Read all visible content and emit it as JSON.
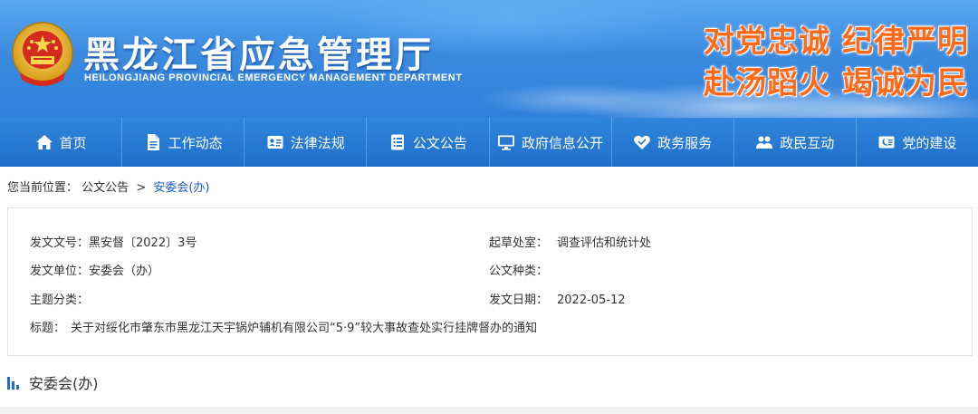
{
  "header": {
    "title": "黑龙江省应急管理厅",
    "subtitle": "HEILONGJIANG PROVINCIAL EMERGENCY MANAGEMENT DEPARTMENT",
    "slogan_line1": "对党忠诚  纪律严明",
    "slogan_line2": "赴汤蹈火  竭诚为民",
    "emblem_icon": "national-emblem-icon",
    "colors": {
      "banner": "#3b8be0",
      "slogan": "#ff6a1a",
      "nav": "#2477d2"
    }
  },
  "nav": {
    "items": [
      {
        "label": "首页",
        "icon": "home-icon"
      },
      {
        "label": "工作动态",
        "icon": "document-icon"
      },
      {
        "label": "法律法规",
        "icon": "id-card-icon"
      },
      {
        "label": "公文公告",
        "icon": "list-icon"
      },
      {
        "label": "政府信息公开",
        "icon": "monitor-icon"
      },
      {
        "label": "政务服务",
        "icon": "heart-icon"
      },
      {
        "label": "政民互动",
        "icon": "users-icon"
      },
      {
        "label": "党的建设",
        "icon": "party-icon"
      }
    ]
  },
  "breadcrumb": {
    "prefix": "您当前位置：",
    "items": [
      "公文公告",
      "安委会(办)"
    ],
    "separator": ">"
  },
  "info": {
    "doc_no_label": "发文文号：",
    "doc_no": "黑安督〔2022〕3号",
    "drafting_label": "起草处室：",
    "drafting": "调查评估和统计处",
    "issuer_label": "发文单位：",
    "issuer": "安委会（办）",
    "doc_type_label": "公文种类：",
    "doc_type": "",
    "topic_label": "主题分类：",
    "topic": "",
    "date_label": "发文日期：",
    "date": "2022-05-12",
    "title_label": "标题：",
    "title": "关于对绥化市肇东市黑龙江天宇锅炉辅机有限公司“5·9”较大事故查处实行挂牌督办的通知"
  },
  "section": {
    "title": "安委会(办)",
    "icon": "bar-chart-icon"
  }
}
